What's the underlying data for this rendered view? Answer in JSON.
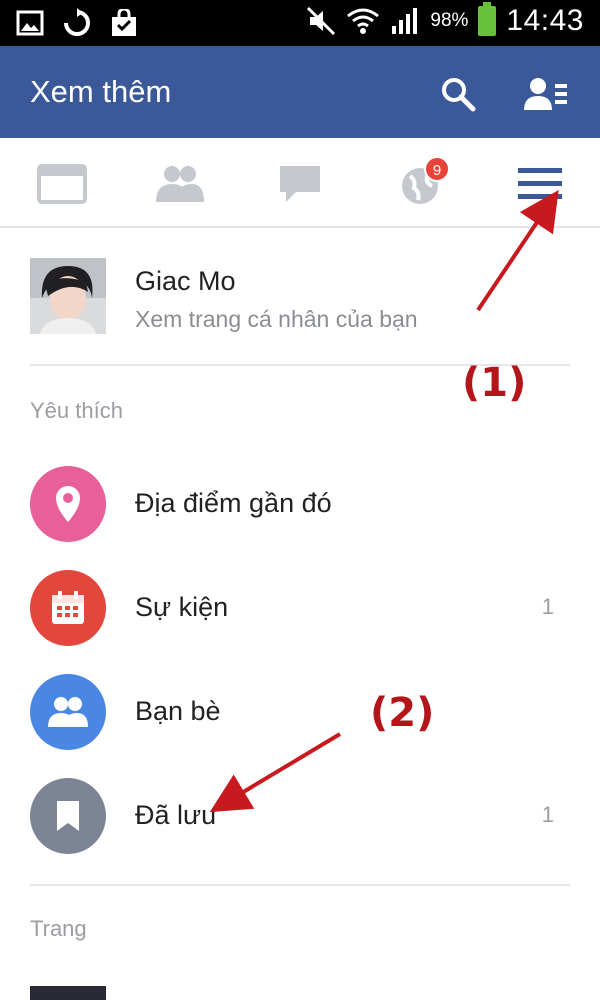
{
  "status_bar": {
    "battery_percent": "98%",
    "time": "14:43",
    "left_icons": [
      "image-icon",
      "sync-icon",
      "shopping-bag-icon"
    ],
    "right_icons": [
      "mute-icon",
      "wifi-icon",
      "signal-icon",
      "battery-icon"
    ]
  },
  "app_bar": {
    "title": "Xem thêm",
    "color": "#3b5998",
    "actions": [
      "search-icon",
      "contacts-icon"
    ]
  },
  "tabs": {
    "items": [
      "news-feed-icon",
      "friends-icon",
      "messages-icon",
      "notifications-globe-icon",
      "menu-icon"
    ],
    "notification_badge": "9",
    "badge_color": "#e9443a"
  },
  "profile": {
    "name": "Giac Mo",
    "subtitle": "Xem trang cá nhân của bạn"
  },
  "favorites": {
    "section_label": "Yêu thích",
    "items": [
      {
        "label": "Địa điểm gần đó",
        "icon": "location-pin-icon",
        "color": "#e8609a",
        "count": ""
      },
      {
        "label": "Sự kiện",
        "icon": "calendar-icon",
        "color": "#e2473d",
        "count": "1"
      },
      {
        "label": "Bạn bè",
        "icon": "friends-icon",
        "color": "#4a86e3",
        "count": ""
      },
      {
        "label": "Đã lưu",
        "icon": "bookmark-icon",
        "color": "#7c8394",
        "count": "1"
      }
    ]
  },
  "pages": {
    "section_label": "Trang"
  },
  "annotations": {
    "label_1": "(1)",
    "label_2": "(2)",
    "color": "#b3151b"
  }
}
